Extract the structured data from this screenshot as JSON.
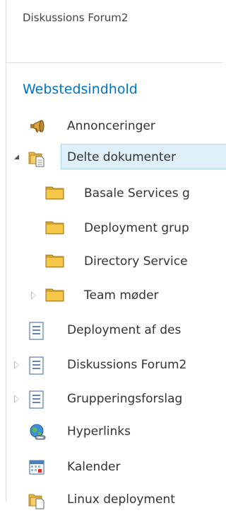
{
  "header": {
    "title": "Diskussions Forum2"
  },
  "nav": {
    "section_title": "Webstedsindhold",
    "items": [
      {
        "label": "Annonceringer",
        "icon": "megaphone-icon"
      },
      {
        "label": "Delte dokumenter",
        "icon": "document-library-icon",
        "expanded": true,
        "selected": true
      },
      {
        "label": "Basale Services g",
        "icon": "folder-icon"
      },
      {
        "label": "Deployment grup",
        "icon": "folder-icon"
      },
      {
        "label": "Directory Service",
        "icon": "folder-icon"
      },
      {
        "label": "Team møder",
        "icon": "folder-icon",
        "expanded": false
      },
      {
        "label": "Deployment af des",
        "icon": "list-icon"
      },
      {
        "label": "Diskussions Forum2",
        "icon": "list-icon",
        "expanded": false
      },
      {
        "label": "Grupperingsforslag",
        "icon": "list-icon",
        "expanded": false
      },
      {
        "label": "Hyperlinks",
        "icon": "globe-link-icon"
      },
      {
        "label": "Kalender",
        "icon": "calendar-icon"
      },
      {
        "label": "Linux deployment",
        "icon": "document-library-icon"
      }
    ]
  },
  "colors": {
    "link": "#0072c6",
    "selected_bg": "#dff0fb",
    "selected_border": "#a8d4f0",
    "folder": "#f5c342"
  }
}
